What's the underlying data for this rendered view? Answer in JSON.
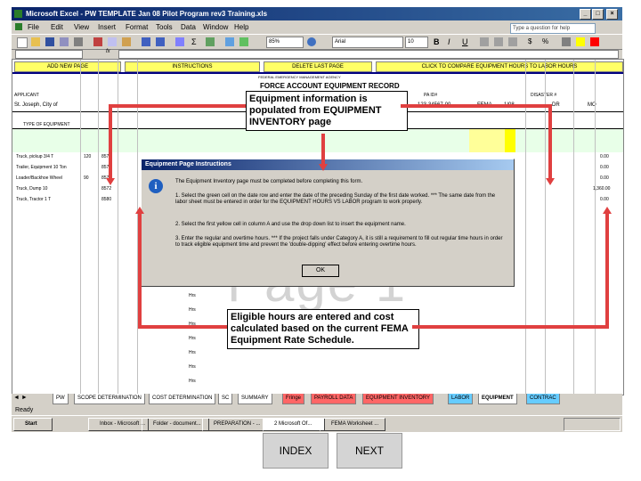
{
  "window": {
    "title": "Microsoft Excel - PW TEMPLATE Jan 08 Pilot Program rev3 Training.xls",
    "ask_placeholder": "Type a question for help",
    "controls": [
      "_",
      "□",
      "×"
    ]
  },
  "menu": [
    "File",
    "Edit",
    "View",
    "Insert",
    "Format",
    "Tools",
    "Data",
    "Window",
    "Help"
  ],
  "toolbar": {
    "zoom": "85%",
    "font": "Arial",
    "font_size": "10"
  },
  "formula_bar": {
    "name_box": "",
    "fx": "fx"
  },
  "sheet": {
    "top_buttons": [
      "ADD NEW PAGE",
      "INSTRUCTIONS",
      "DELETE LAST PAGE",
      "CLICK TO COMPARE EQUIPMENT HOURS TO LABOR HOURS"
    ],
    "agency": "FEDERAL EMERGENCY MANAGEMENT AGENCY",
    "record_title": "FORCE ACCOUNT EQUIPMENT RECORD",
    "applicant_label": "APPLICANT",
    "applicant_value": "St. Joseph, City of",
    "pa_label": "PA ID#",
    "pa_value": "123-34567-00",
    "program": "FEMA",
    "date": "1/08",
    "disaster_label": "DISASTER #",
    "disaster_value": "DR",
    "state": "MO",
    "type_of_equipment": "TYPE OF EQUIPMENT",
    "equipment_rows": [
      {
        "name": "Truck, pickup 3/4 T",
        "hp": "120",
        "code": "8578",
        "total": "0.00"
      },
      {
        "name": "Trailer, Equipment 10 Ton",
        "hp": "",
        "code": "8570",
        "total": "0.00"
      },
      {
        "name": "Loader/Backhoe Wheel",
        "hp": "90",
        "code": "8571",
        "total": "0.00"
      },
      {
        "name": "Truck, Dump 10",
        "hp": "",
        "code": "8572",
        "total": "1,360.00"
      },
      {
        "name": "Truck, Tractor 1 T",
        "hp": "",
        "code": "8580",
        "total": "0.00"
      }
    ],
    "row_labels": [
      "Hrs",
      "Hrs",
      "Hrs",
      "Hrs",
      "Hrs",
      "Hrs",
      "Hrs",
      "Hrs",
      "Hrs",
      "Hrs",
      "Hrs",
      "Hrs",
      "Hrs",
      "Hrs",
      "Hrs"
    ],
    "watermark": "Page 1"
  },
  "callouts": {
    "top": "Equipment information is populated from EQUIPMENT INVENTORY page",
    "bottom": "Eligible hours are entered and cost calculated based on the current FEMA Equipment Rate Schedule."
  },
  "dialog": {
    "title": "Equipment Page Instructions",
    "intro": "The Equipment Inventory page must be completed before completing this form.",
    "step1": "1. Select the green cell on the date row and enter the date of the preceding Sunday of the first date worked. *** The same date from the labor sheet must be entered in order for the EQUIPMENT HOURS VS LABOR program to work properly.",
    "step2": "2. Select the first yellow cell in column A and use the drop down list to insert the equipment name.",
    "step3": "3. Enter the regular and overtime hours. *** If the project falls under Category A, it is still a requirement to fill out regular time hours in order to track eligible equipment time and prevent the 'double-dipping' effect before entering overtime hours.",
    "ok": "OK"
  },
  "sheet_tabs": [
    "PW",
    "SCOPE DETERMINATION",
    "COST DETERMINATION",
    "SC",
    "SUMMARY",
    "Fringe",
    "PAYROLL DATA",
    "EQUIPMENT INVENTORY",
    "LABOR",
    "EQUIPMENT",
    "CONTRAC"
  ],
  "status": "Ready",
  "taskbar": {
    "start": "Start",
    "tasks": [
      "Inbox - Microsoft ...",
      "Folder - document...",
      "PREPARATION - ...",
      "2 Microsoft Of...",
      "FEMA Worksheet ..."
    ],
    "tray_items": 3
  },
  "nav": {
    "index": "INDEX",
    "next": "NEXT"
  },
  "colors": {
    "arrow": "#e04040",
    "title_bar": "#0a246a",
    "highlight_yellow": "#ffff66"
  }
}
